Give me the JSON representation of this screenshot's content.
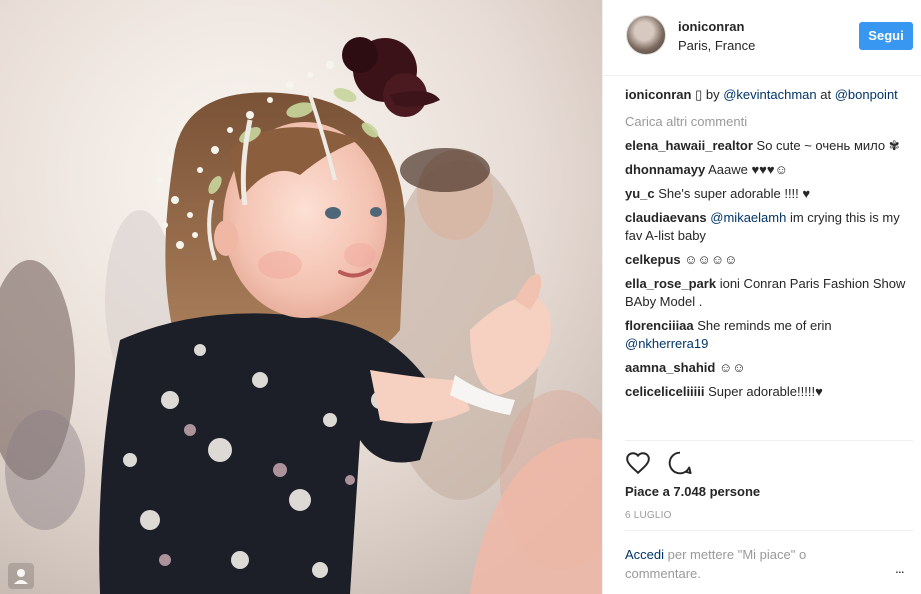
{
  "post": {
    "photo_icon": "user-tag-icon"
  },
  "header": {
    "username": "ioniconran",
    "location": "Paris, France",
    "follow_label": "Segui"
  },
  "caption": {
    "user": "ioniconran",
    "glyph": "▯",
    "by": " by ",
    "mention1": "@kevintachman",
    "at": " at",
    "mention2": "@bonpoint"
  },
  "load_more": "Carica altri commenti",
  "comments": [
    {
      "user": "elena_hawaii_realtor",
      "text": "So cute ~ очень мило ✾"
    },
    {
      "user": "dhonnamayy",
      "text": "Aaawe ♥♥♥☺"
    },
    {
      "user": "yu_c",
      "text": "She's super adorable !!!! ♥"
    },
    {
      "user": "claudiaevans",
      "mention": "@mikaelamh",
      "text": " im crying this is my fav A-list baby"
    },
    {
      "user": "celkepus",
      "text": "☺☺☺☺"
    },
    {
      "user": "ella_rose_park",
      "text": "ioni Conran Paris Fashion Show BAby Model ."
    },
    {
      "user": "florenciiiaa",
      "text": "She reminds me of erin",
      "mention_after": "@nkherrera19"
    },
    {
      "user": "aamna_shahid",
      "text": "☺☺"
    },
    {
      "user": "celiceliceliiiii",
      "text": "Super adorable!!!!!♥"
    }
  ],
  "actions": {
    "like_icon": "heart-icon",
    "comment_icon": "comment-icon"
  },
  "likes": "Piace a 7.048 persone",
  "date": "6 LUGLIO",
  "login": {
    "link": "Accedi",
    "text": " per mettere \"Mi piace\" o commentare."
  },
  "more_options": "..."
}
